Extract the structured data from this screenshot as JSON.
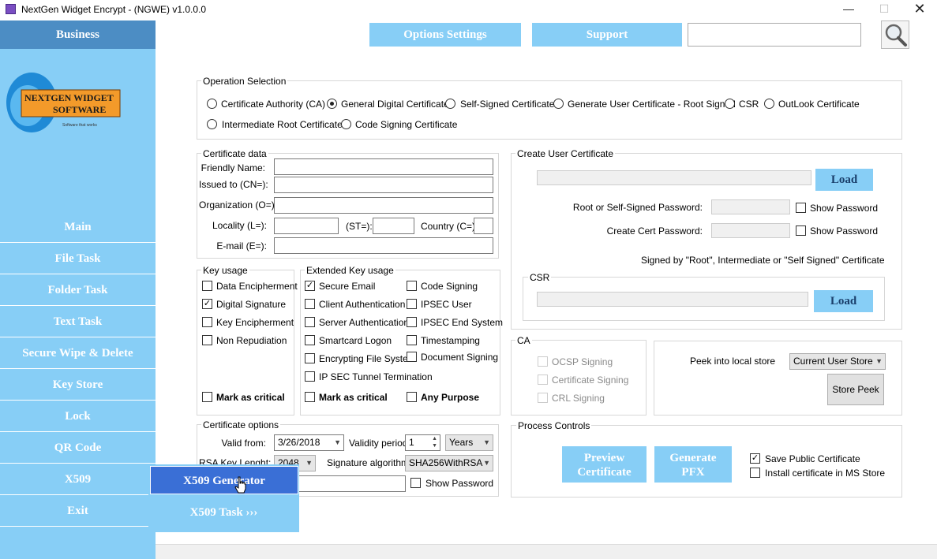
{
  "window": {
    "title": "NextGen Widget Encrypt - (NGWE) v1.0.0.0",
    "minimize_icon": "minimize-icon",
    "maximize_icon": "maximize-icon",
    "close_icon": "close-icon"
  },
  "colors": {
    "sidebar": "#87cef6",
    "sidebar_header": "#4c8dc4",
    "popup_selected": "#3a6fd6"
  },
  "sidebar": {
    "header": "Business",
    "logo_line1": "NEXTGEN WIDGET",
    "logo_line2": "SOFTWARE",
    "logo_tagline": "Software that works",
    "items": [
      "Main",
      "File Task",
      "Folder Task",
      "Text Task",
      "Secure Wipe & Delete",
      "Key Store",
      "Lock",
      "QR Code",
      "X509",
      "Exit"
    ]
  },
  "toolbar": {
    "options_label": "Options Settings",
    "support_label": "Support",
    "search_value": "",
    "search_icon": "magnifier-icon"
  },
  "operation": {
    "legend": "Operation Selection",
    "options": [
      "Certificate Authority  (CA)",
      "General Digital Certificate",
      "Self-Signed Certificate",
      "Generate User Certificate - Root Signed",
      "CSR",
      "OutLook Certificate",
      "Intermediate Root Certificate",
      "Code Signing Certificate"
    ],
    "selected": "General Digital Certificate"
  },
  "cert_data": {
    "legend": "Certificate data",
    "friendly_label": "Friendly Name:",
    "cn_label": "Issued to (CN=):",
    "org_label": "Organization (O=):",
    "locality_label": "Locality (L=):",
    "st_label": "(ST=):",
    "country_label": "Country (C=):",
    "email_label": "E-mail (E=):"
  },
  "key_usage": {
    "legend": "Key usage",
    "items": [
      {
        "label": "Data Encipherment",
        "checked": false
      },
      {
        "label": "Digital Signature",
        "checked": true
      },
      {
        "label": "Key Encipherment",
        "checked": false
      },
      {
        "label": "Non Repudiation",
        "checked": false
      }
    ],
    "critical": "Mark as critical"
  },
  "ext_key_usage": {
    "legend": "Extended Key usage",
    "col1": [
      {
        "label": "Secure Email",
        "checked": true
      },
      {
        "label": "Client Authentication",
        "checked": false
      },
      {
        "label": "Server Authentication",
        "checked": false
      },
      {
        "label": "Smartcard Logon",
        "checked": false
      },
      {
        "label": "Encrypting File System",
        "checked": false
      },
      {
        "label": "IP SEC Tunnel Termination",
        "checked": false
      }
    ],
    "col2": [
      {
        "label": "Code Signing",
        "checked": false
      },
      {
        "label": "IPSEC User",
        "checked": false
      },
      {
        "label": "IPSEC End System",
        "checked": false
      },
      {
        "label": "Timestamping",
        "checked": false
      },
      {
        "label": "Document Signing",
        "checked": false
      }
    ],
    "critical": "Mark as critical",
    "any_purpose": "Any Purpose"
  },
  "cert_options": {
    "legend": "Certificate options",
    "valid_from_label": "Valid from:",
    "valid_from": "3/26/2018",
    "validity_label": "Validity period:",
    "validity_value": "1",
    "validity_unit": "Years",
    "rsa_label": "RSA Key Lenght:",
    "rsa_value": "2048",
    "sig_label": "Signature algorithm:",
    "sig_value": "SHA256WithRSA",
    "show_password": "Show Password"
  },
  "user_cert": {
    "legend": "Create User Certificate",
    "load_label": "Load",
    "root_pw_label": "Root or Self-Signed  Password:",
    "show_pw1": "Show Password",
    "create_pw_label": "Create Cert Password:",
    "show_pw2": "Show Password",
    "signed_note": "Signed by \"Root\", Intermediate or \"Self Signed\" Certificate",
    "csr_legend": "CSR",
    "csr_load_label": "Load"
  },
  "ca": {
    "legend": "CA",
    "items": [
      "OCSP Signing",
      "Certificate Signing",
      "CRL Signing"
    ]
  },
  "peek": {
    "label": "Peek into local store",
    "store_value": "Current User Store",
    "button": "Store Peek"
  },
  "process": {
    "legend": "Process Controls",
    "preview_line1": "Preview",
    "preview_line2": "Certificate",
    "pfx_line1": "Generate",
    "pfx_line2": "PFX",
    "save_public": "Save Public Certificate",
    "save_public_checked": true,
    "install_ms": "Install certificate in MS Store",
    "install_ms_checked": false
  },
  "popup": {
    "generator": "X509 Generator",
    "task": "X509 Task ›››"
  }
}
